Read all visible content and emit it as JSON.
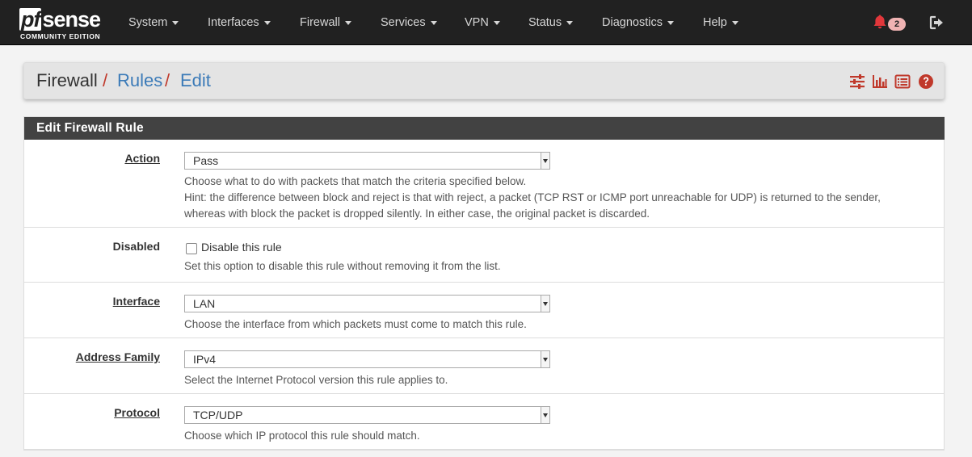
{
  "brand": {
    "logo_pf": "pf",
    "logo_sense": "sense",
    "edition": "COMMUNITY EDITION"
  },
  "nav": {
    "items": [
      "System",
      "Interfaces",
      "Firewall",
      "Services",
      "VPN",
      "Status",
      "Diagnostics",
      "Help"
    ],
    "notification_count": "2",
    "icons": {
      "notifications": "bell-icon",
      "logout": "sign-out-icon"
    }
  },
  "breadcrumb": {
    "root": "Firewall",
    "level2": "Rules",
    "level3": "Edit",
    "separator": "/",
    "separator_color": "#c0392b",
    "link_color": "#3c7bb8",
    "icons": [
      "sliders-icon",
      "bar-chart-icon",
      "list-icon",
      "question-circle-icon"
    ]
  },
  "panel": {
    "title": "Edit Firewall Rule",
    "rows": {
      "action": {
        "label": "Action",
        "value": "Pass",
        "help": [
          "Choose what to do with packets that match the criteria specified below.",
          "Hint: the difference between block and reject is that with reject, a packet (TCP RST or ICMP port unreachable for UDP) is returned to the sender,",
          "whereas with block the packet is dropped silently. In either case, the original packet is discarded."
        ]
      },
      "disabled": {
        "label": "Disabled",
        "checkbox_label": "Disable this rule",
        "checked": false,
        "help": "Set this option to disable this rule without removing it from the list."
      },
      "interface": {
        "label": "Interface",
        "value": "LAN",
        "help": "Choose the interface from which packets must come to match this rule."
      },
      "address_family": {
        "label": "Address Family",
        "value": "IPv4",
        "help": "Select the Internet Protocol version this rule applies to."
      },
      "protocol": {
        "label": "Protocol",
        "value": "TCP/UDP",
        "help": "Choose which IP protocol this rule should match."
      }
    }
  },
  "colors": {
    "navbar_bg": "#212121",
    "panel_head_bg": "#424242",
    "accent_red": "#c0392b",
    "link_blue": "#3c7bb8"
  }
}
